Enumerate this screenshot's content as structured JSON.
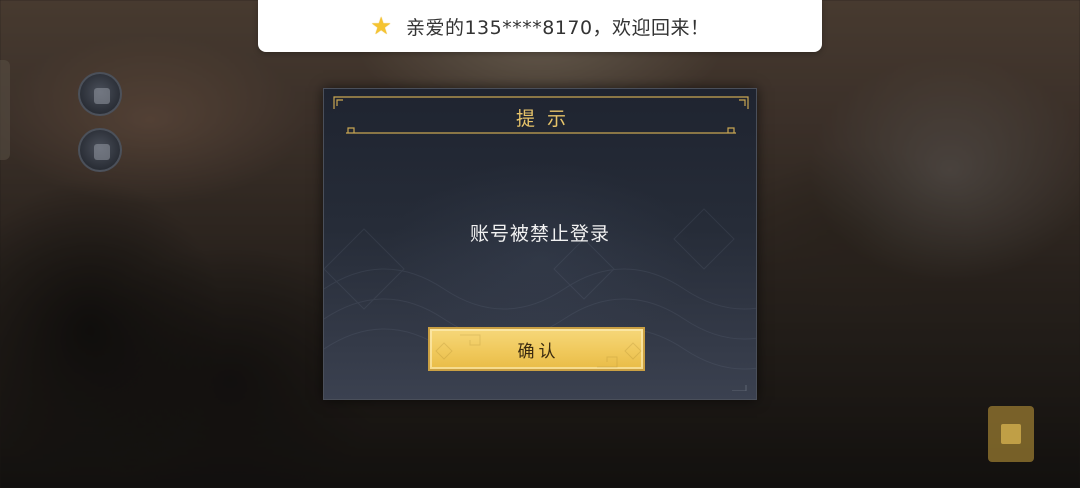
{
  "toast": {
    "icon": "star-icon",
    "message": "亲爱的135****8170，欢迎回来！"
  },
  "dialog": {
    "title": "提示",
    "message": "账号被禁止登录",
    "confirm_label": "确认"
  },
  "colors": {
    "gold_accent": "#e7c46a",
    "button_gold": "#f0c95c",
    "dialog_bg": "#262c38",
    "toast_bg": "#ffffff",
    "star": "#f5c431"
  }
}
